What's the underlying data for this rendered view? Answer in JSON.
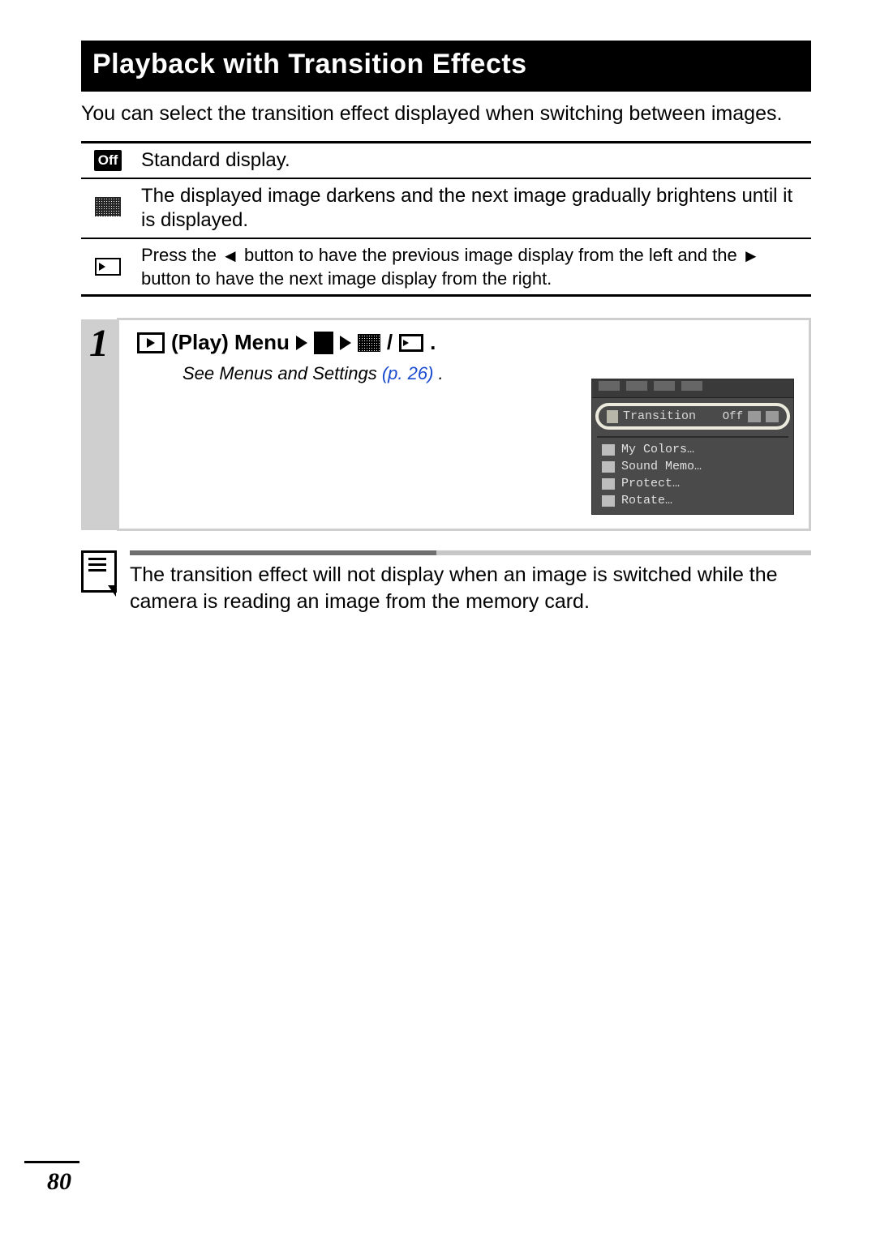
{
  "title": "Playback with Transition Effects",
  "intro": "You can select the transition effect displayed when switching between images.",
  "effects": {
    "off_badge": "Off",
    "row1": "Standard display.",
    "row2": "The displayed image darkens and the next image gradually brightens until it is displayed.",
    "row3_a": "Press the ",
    "row3_b": " button to have the previous image display from the left and the ",
    "row3_c": " button to have the next image display from the right."
  },
  "step": {
    "number": "1",
    "menu_label": " (Play) Menu",
    "slash": "/",
    "period": ".",
    "see_prefix": "See Menus and Settings ",
    "see_page": "(p. 26)",
    "see_period": "."
  },
  "cam_menu": {
    "transition_label": "Transition",
    "transition_value": "Off",
    "items": [
      "My Colors…",
      "Sound Memo…",
      "Protect…",
      "Rotate…"
    ]
  },
  "note": "The transition effect will not display when an image is switched while the camera is reading an image from the memory card.",
  "page_number": "80"
}
